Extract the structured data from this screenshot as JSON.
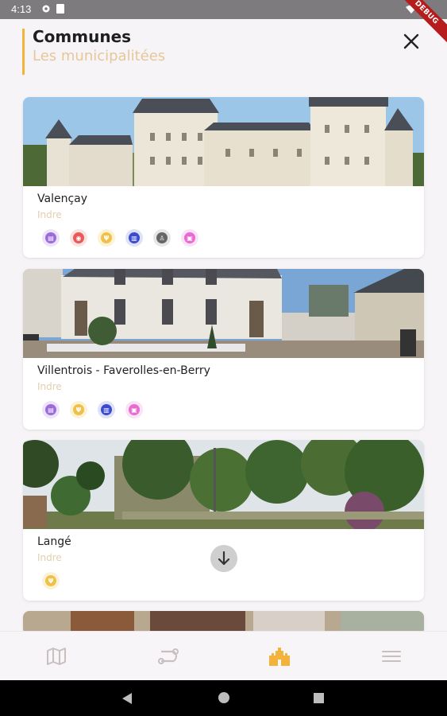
{
  "status_bar": {
    "time": "4:13",
    "debug_label": "DEBUG"
  },
  "header": {
    "title": "Communes",
    "subtitle": "Les municipalitées"
  },
  "communes": [
    {
      "name": "Valençay",
      "department": "Indre",
      "badges": [
        {
          "icon": "museum-icon",
          "color": "#9b6bd9"
        },
        {
          "icon": "restaurant-icon",
          "color": "#e85a5a"
        },
        {
          "icon": "food-icon",
          "color": "#f0c04a"
        },
        {
          "icon": "monument-icon",
          "color": "#3a4bd0"
        },
        {
          "icon": "toilets-icon",
          "color": "#666666"
        },
        {
          "icon": "shop-icon",
          "color": "#e76bd0"
        }
      ]
    },
    {
      "name": "Villentrois - Faverolles-en-Berry",
      "department": "Indre",
      "badges": [
        {
          "icon": "museum-icon",
          "color": "#9b6bd9"
        },
        {
          "icon": "food-icon",
          "color": "#f0c04a"
        },
        {
          "icon": "monument-icon",
          "color": "#3a4bd0"
        },
        {
          "icon": "shop-icon",
          "color": "#e76bd0"
        }
      ]
    },
    {
      "name": "Langé",
      "department": "Indre",
      "badges": [
        {
          "icon": "food-icon",
          "color": "#f0c04a"
        }
      ]
    }
  ],
  "bottom_nav": [
    {
      "icon": "map-icon",
      "active": false
    },
    {
      "icon": "route-icon",
      "active": false
    },
    {
      "icon": "castle-icon",
      "active": true
    },
    {
      "icon": "menu-icon",
      "active": false
    }
  ],
  "colors": {
    "accent": "#f3b33b",
    "accent_light": "#e7c79a",
    "inactive_icon": "#c8bfbf"
  }
}
